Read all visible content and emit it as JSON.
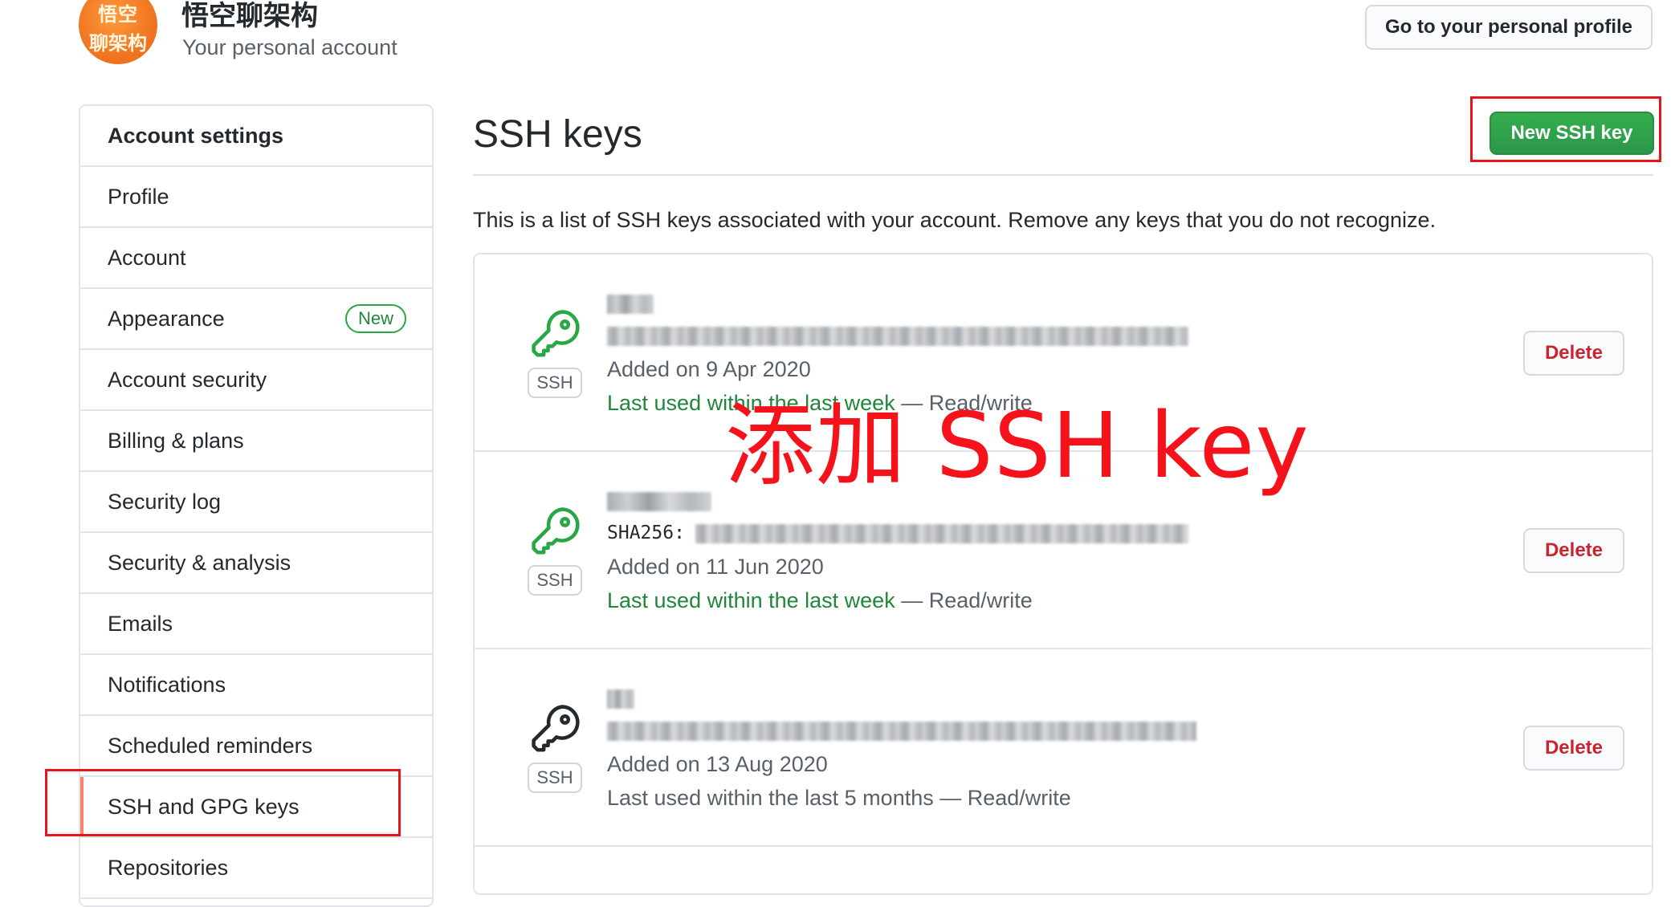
{
  "header": {
    "avatar_line1": "悟空",
    "avatar_line2": "聊架构",
    "account_name": "悟空聊架构",
    "account_subtitle": "Your personal account",
    "profile_button": "Go to your personal profile"
  },
  "sidebar": {
    "heading": "Account settings",
    "items": [
      {
        "label": "Profile"
      },
      {
        "label": "Account"
      },
      {
        "label": "Appearance",
        "badge": "New"
      },
      {
        "label": "Account security"
      },
      {
        "label": "Billing & plans"
      },
      {
        "label": "Security log"
      },
      {
        "label": "Security & analysis"
      },
      {
        "label": "Emails"
      },
      {
        "label": "Notifications"
      },
      {
        "label": "Scheduled reminders"
      },
      {
        "label": "SSH and GPG keys",
        "selected": true
      },
      {
        "label": "Repositories"
      }
    ]
  },
  "main": {
    "title": "SSH keys",
    "new_key_button": "New SSH key",
    "intro": "This is a list of SSH keys associated with your account. Remove any keys that you do not recognize.",
    "keys": [
      {
        "badge": "SSH",
        "added": "Added on 9 Apr 2020",
        "last_used_recent": "Last used within the last week",
        "last_used_rest": " — Read/write",
        "delete_label": "Delete",
        "icon_color": "#28a745"
      },
      {
        "badge": "SSH",
        "sha_label": "SHA256:",
        "added": "Added on 11 Jun 2020",
        "last_used_recent": "Last used within the last week",
        "last_used_rest": " — Read/write",
        "delete_label": "Delete",
        "icon_color": "#28a745"
      },
      {
        "badge": "SSH",
        "added": "Added on 13 Aug 2020",
        "last_used_recent": "",
        "last_used_rest": "Last used within the last 5 months — Read/write",
        "delete_label": "Delete",
        "icon_color": "#24292e"
      }
    ]
  },
  "annotation": {
    "text": "添加 SSH key",
    "color": "#f5121b"
  }
}
